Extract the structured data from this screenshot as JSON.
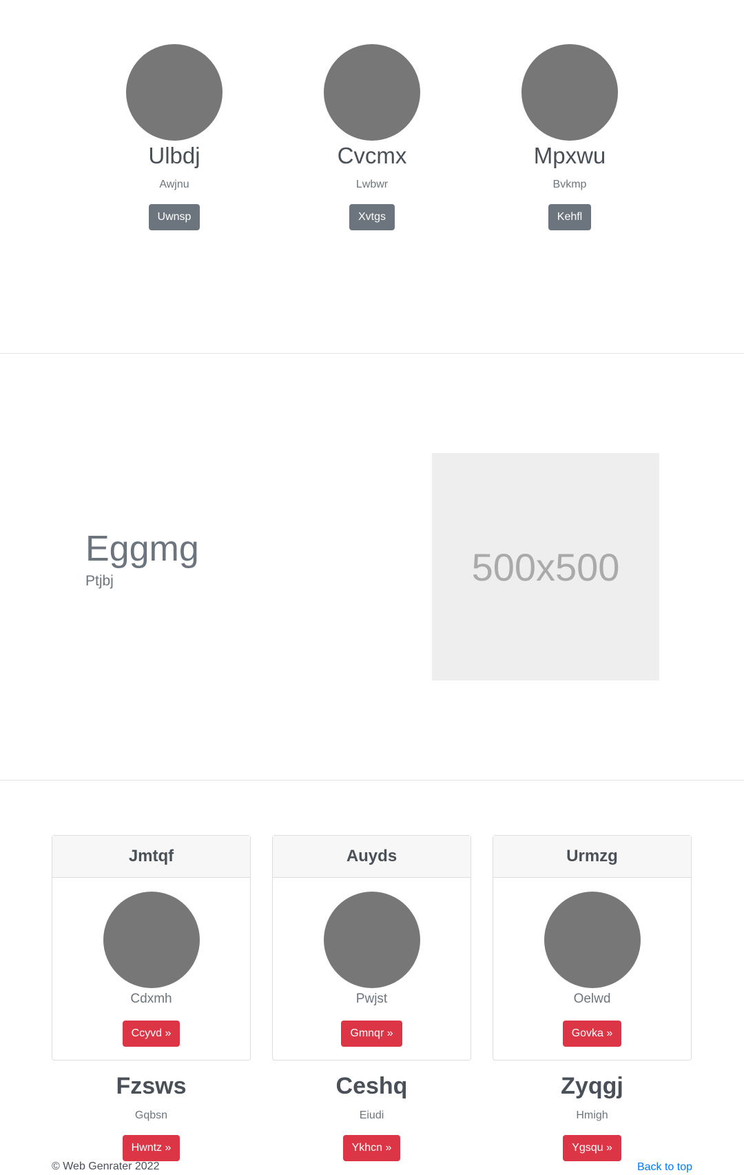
{
  "team": [
    {
      "name": "Ulbdj",
      "role": "Awjnu",
      "button": "Uwnsp"
    },
    {
      "name": "Cvcmx",
      "role": "Lwbwr",
      "button": "Xvtgs"
    },
    {
      "name": "Mpxwu",
      "role": "Bvkmp",
      "button": "Kehfl"
    }
  ],
  "feature": {
    "title": "Eggmg",
    "subtitle": "Ptjbj",
    "placeholder_text": "500x500"
  },
  "cards": [
    {
      "header": "Jmtqf",
      "subtitle": "Cdxmh",
      "button": "Ccyvd »"
    },
    {
      "header": "Auyds",
      "subtitle": "Pwjst",
      "button": "Gmnqr »"
    },
    {
      "header": "Urmzg",
      "subtitle": "Oelwd",
      "button": "Govka »"
    }
  ],
  "columns": [
    {
      "title": "Fzsws",
      "subtitle": "Gqbsn",
      "button": "Hwntz »"
    },
    {
      "title": "Ceshq",
      "subtitle": "Eiudi",
      "button": "Ykhcn »"
    },
    {
      "title": "Zyqgj",
      "subtitle": "Hmigh",
      "button": "Ygsqu »"
    }
  ],
  "footer": {
    "copyright": "© Web Genrater 2022",
    "back_to_top": "Back to top"
  },
  "colors": {
    "avatar": "#777777",
    "secondary_button": "#6c757d",
    "danger_button": "#dc3545",
    "link": "#007bff",
    "placeholder_bg": "#eeeeee"
  }
}
